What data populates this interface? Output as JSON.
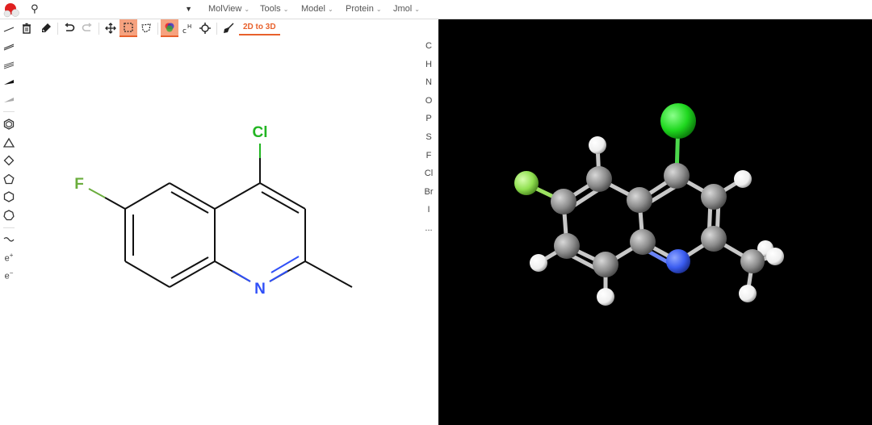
{
  "topbar": {
    "logo": "molecule-logo",
    "search": {
      "value": "",
      "placeholder": ""
    },
    "menus": [
      {
        "label": "MolView"
      },
      {
        "label": "Tools"
      },
      {
        "label": "Model"
      },
      {
        "label": "Protein"
      },
      {
        "label": "Jmol"
      }
    ]
  },
  "toolbar": {
    "tools": [
      {
        "name": "trash-icon",
        "active": false
      },
      {
        "name": "eraser-icon",
        "active": false
      },
      {
        "name": "undo-icon",
        "active": false
      },
      {
        "name": "redo-icon",
        "active": false,
        "disabled": true
      },
      {
        "name": "move-icon",
        "active": false
      },
      {
        "name": "rect-select-icon",
        "active": true
      },
      {
        "name": "lasso-select-icon",
        "active": false
      },
      {
        "name": "color-mode-icon",
        "active": true
      },
      {
        "name": "hydrogen-icon",
        "active": false
      },
      {
        "name": "center-icon",
        "active": false
      },
      {
        "name": "clean-icon",
        "active": false
      }
    ],
    "to3d_label": "2D to 3D"
  },
  "left_tools": {
    "bonds": [
      "single-bond-icon",
      "double-bond-icon",
      "triple-bond-icon",
      "wedge-bond-icon",
      "hash-bond-icon"
    ],
    "rings": [
      "benzene-icon",
      "triangle-ring-icon",
      "square-ring-icon",
      "pentagon-ring-icon",
      "hexagon-ring-icon",
      "heptagon-ring-icon"
    ],
    "extras": [
      {
        "name": "chain-icon",
        "label": "~"
      },
      {
        "name": "charge-plus-icon",
        "label": "e",
        "sup": "+"
      },
      {
        "name": "charge-minus-icon",
        "label": "e",
        "sup": "−"
      }
    ]
  },
  "elements": [
    "C",
    "H",
    "N",
    "O",
    "P",
    "S",
    "F",
    "Cl",
    "Br",
    "I",
    "..."
  ],
  "molecule_2d": {
    "atom_labels": [
      {
        "symbol": "Cl",
        "color": "#22b522"
      },
      {
        "symbol": "F",
        "color": "#6aad3c"
      },
      {
        "symbol": "N",
        "color": "#3050f8"
      }
    ]
  },
  "colors": {
    "accent": "#e8612c",
    "accent_bg": "#f6a27f",
    "carbon": "#8c8c8c",
    "hydrogen": "#ffffff",
    "nitrogen": "#3050f8",
    "chlorine": "#1fd81f",
    "fluorine": "#90e050",
    "viewer_bg": "#000000"
  }
}
